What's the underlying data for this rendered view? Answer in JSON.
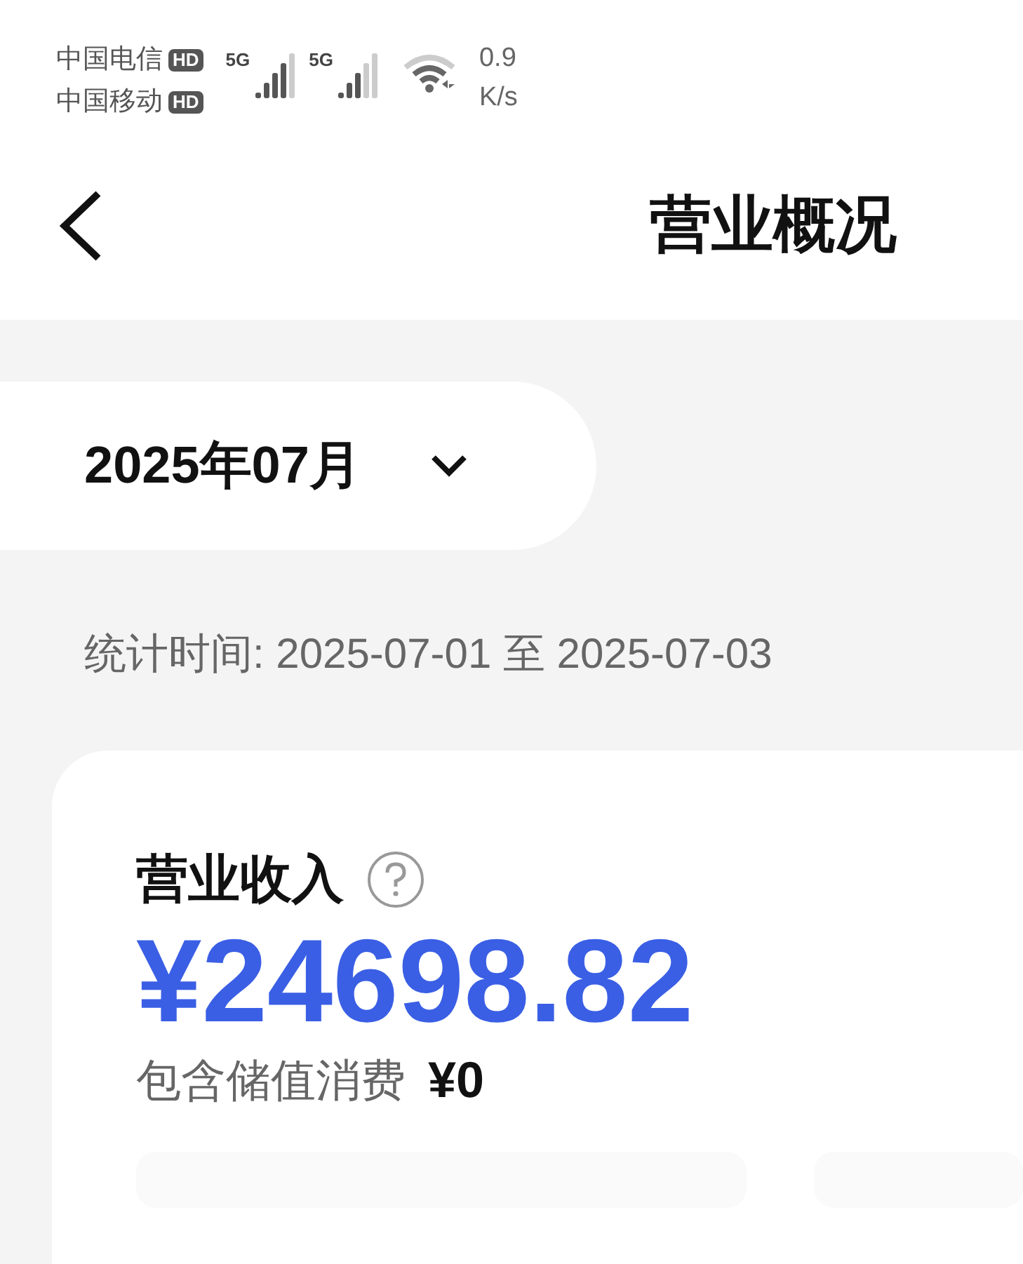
{
  "status_bar": {
    "carriers": [
      {
        "name": "中国电信",
        "badge": "HD"
      },
      {
        "name": "中国移动",
        "badge": "HD"
      }
    ],
    "networks": [
      "5G",
      "5G"
    ],
    "speed": "0.9",
    "speed_unit": "K/s"
  },
  "header": {
    "title": "营业概况"
  },
  "month_selector": {
    "value": "2025年07月"
  },
  "period": "统计时间: 2025-07-01 至 2025-07-03",
  "revenue_card": {
    "label": "营业收入",
    "amount": "¥24698.82",
    "sub_label": "包含储值消费",
    "sub_value": "¥0"
  }
}
